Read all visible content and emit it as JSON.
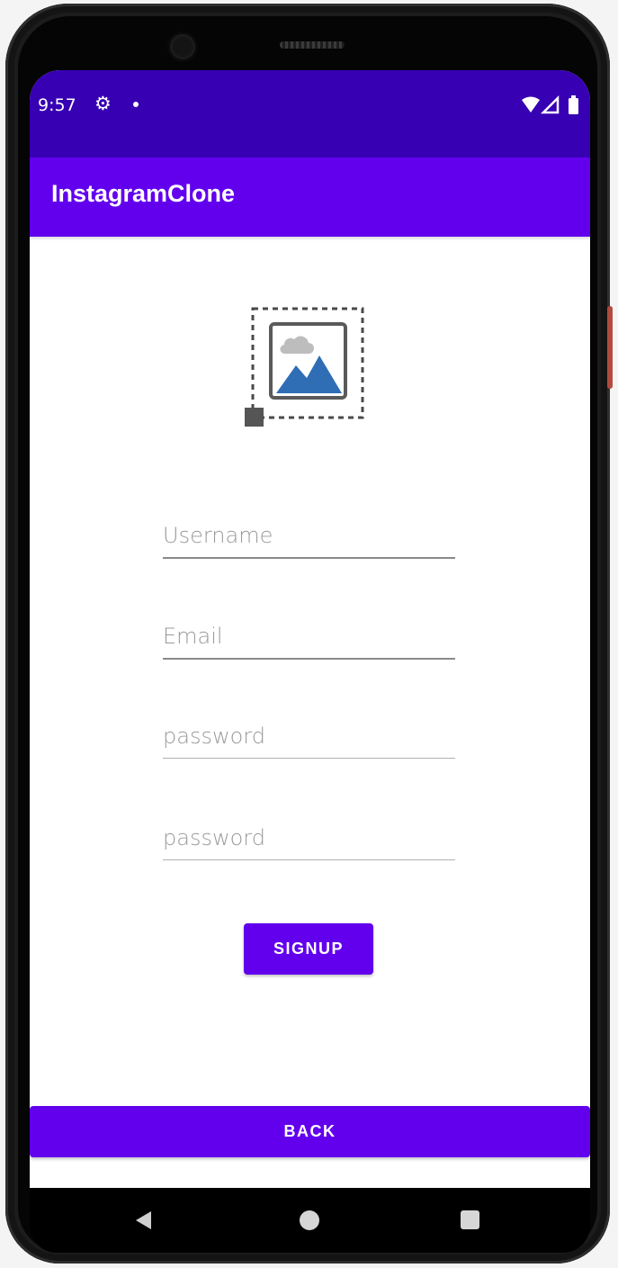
{
  "status_bar": {
    "time": "9:57"
  },
  "app_bar": {
    "title": "InstagramClone"
  },
  "form": {
    "username_placeholder": "Username",
    "email_placeholder": "Email",
    "password_placeholder": "password",
    "confirm_password_placeholder": "password"
  },
  "buttons": {
    "signup_label": "SIGNUP",
    "back_label": "BACK"
  },
  "colors": {
    "status_bar": "#3700b3",
    "primary": "#6200ee",
    "image_accent": "#2f6eb5"
  },
  "icons": {
    "settings": "gear-icon",
    "notification_dot": "dot-icon",
    "wifi": "wifi-icon",
    "signal": "signal-icon",
    "battery": "battery-icon",
    "placeholder_image": "image-placeholder-icon",
    "nav_back": "back-triangle-icon",
    "nav_home": "home-circle-icon",
    "nav_recents": "recents-square-icon"
  }
}
